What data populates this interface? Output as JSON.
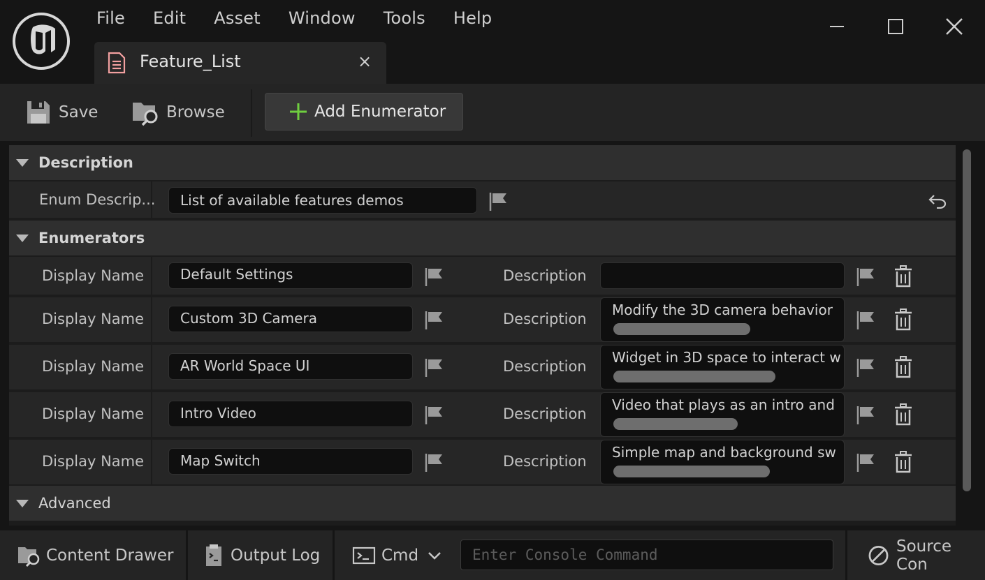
{
  "menu": [
    "File",
    "Edit",
    "Asset",
    "Window",
    "Tools",
    "Help"
  ],
  "tab": {
    "title": "Feature_List",
    "close": "×"
  },
  "toolbar": {
    "save": "Save",
    "browse": "Browse",
    "add_enumerator": "Add Enumerator"
  },
  "description_section": {
    "title": "Description",
    "enum_label": "Enum Descrip...",
    "enum_value": "List of available features demos"
  },
  "enumerators_section": {
    "title": "Enumerators",
    "display_name_label": "Display Name",
    "description_label": "Description",
    "rows": [
      {
        "name": "Default Settings",
        "description": ""
      },
      {
        "name": "Custom 3D Camera",
        "description": "Modify the 3D camera behavior"
      },
      {
        "name": "AR World Space UI",
        "description": "Widget in 3D space to interact w"
      },
      {
        "name": "Intro Video",
        "description": "Video that plays as an intro and"
      },
      {
        "name": "Map Switch",
        "description": "Simple map and background sw"
      }
    ]
  },
  "advanced_section": {
    "title": "Advanced"
  },
  "statusbar": {
    "content_drawer": "Content Drawer",
    "output_log": "Output Log",
    "cmd": "Cmd",
    "console_placeholder": "Enter Console Command",
    "source_control": "Source Con"
  },
  "colors": {
    "accent_green": "#6fcf3f",
    "corner_blue": "#1e7fd6",
    "tab_icon": "#f2a0a0"
  }
}
